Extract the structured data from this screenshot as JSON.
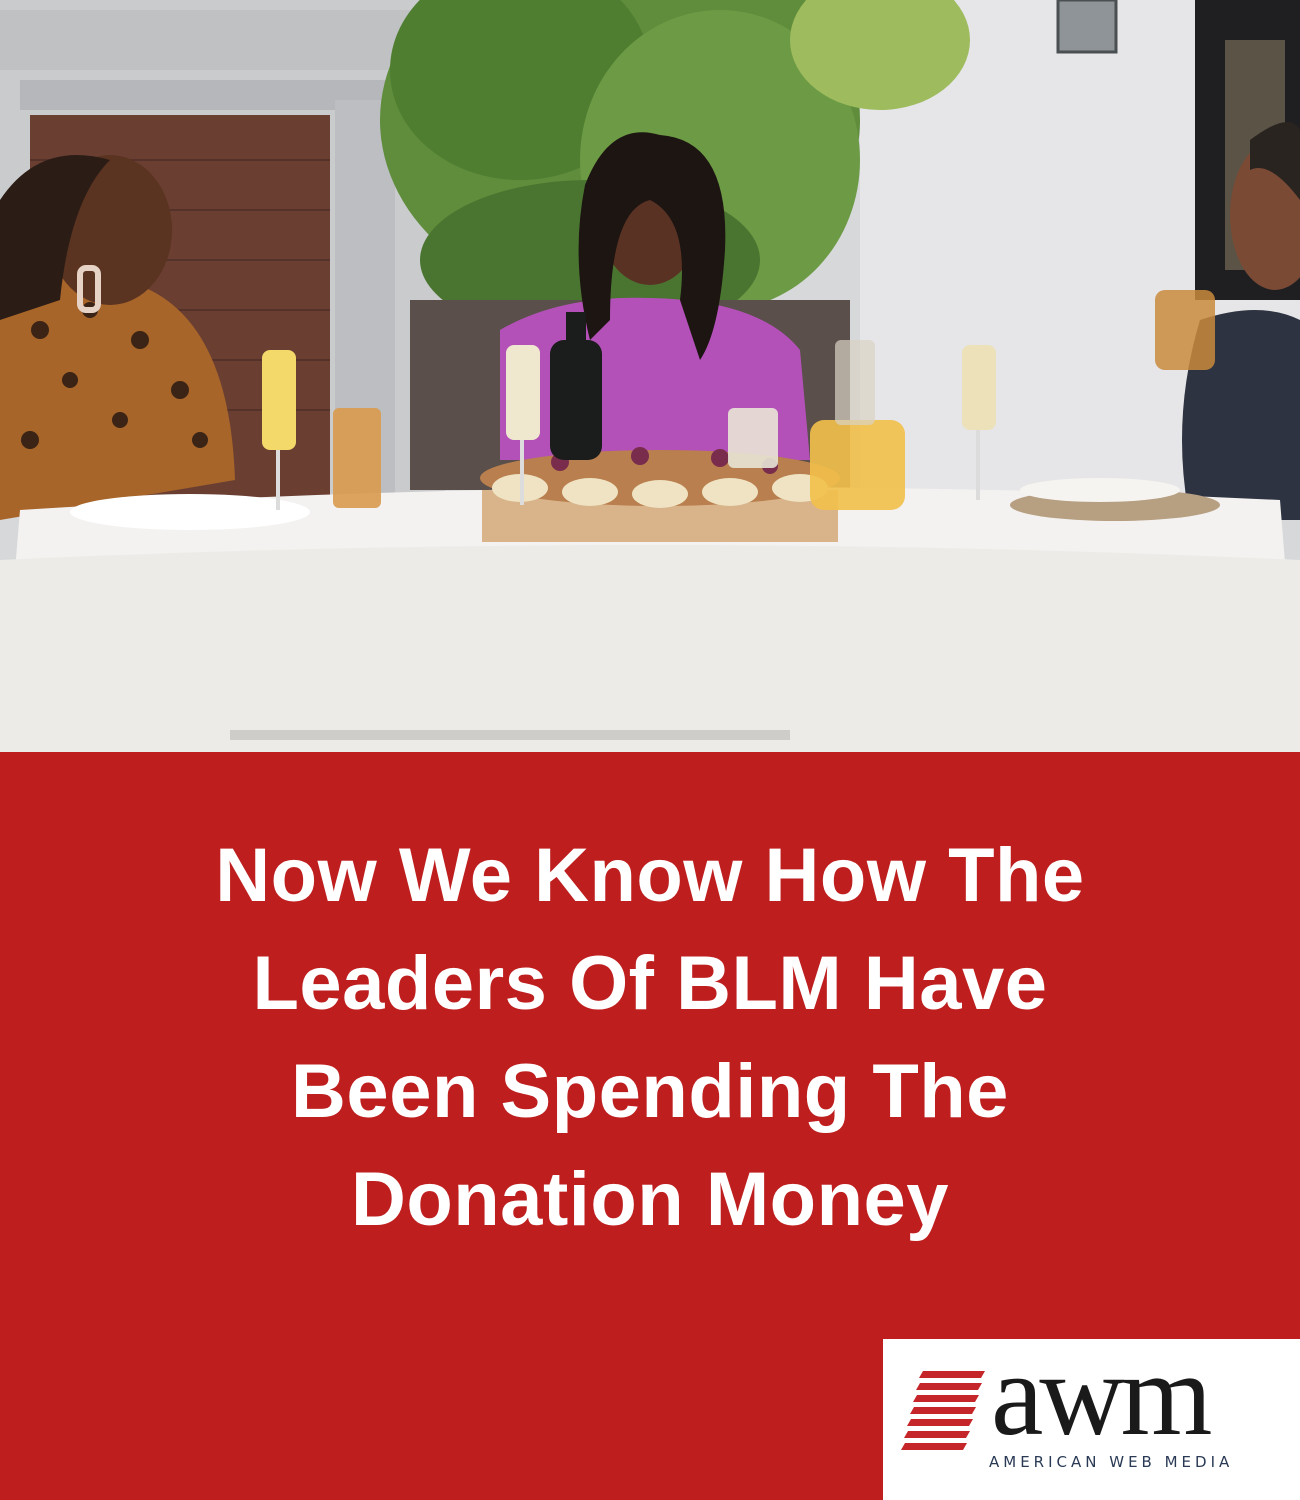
{
  "photo": {
    "description_icon": "outdoor-brunch-photo"
  },
  "headline": {
    "line1": "Now We Know How The",
    "line2": "Leaders Of BLM Have",
    "line3": "Been Spending The",
    "line4": "Donation Money"
  },
  "logo": {
    "wordmark": "awm",
    "tagline": "AMERICAN WEB MEDIA"
  },
  "colors": {
    "banner": "#be1e1e",
    "headline_text": "#ffffff",
    "logo_stripes": "#c4262a"
  }
}
